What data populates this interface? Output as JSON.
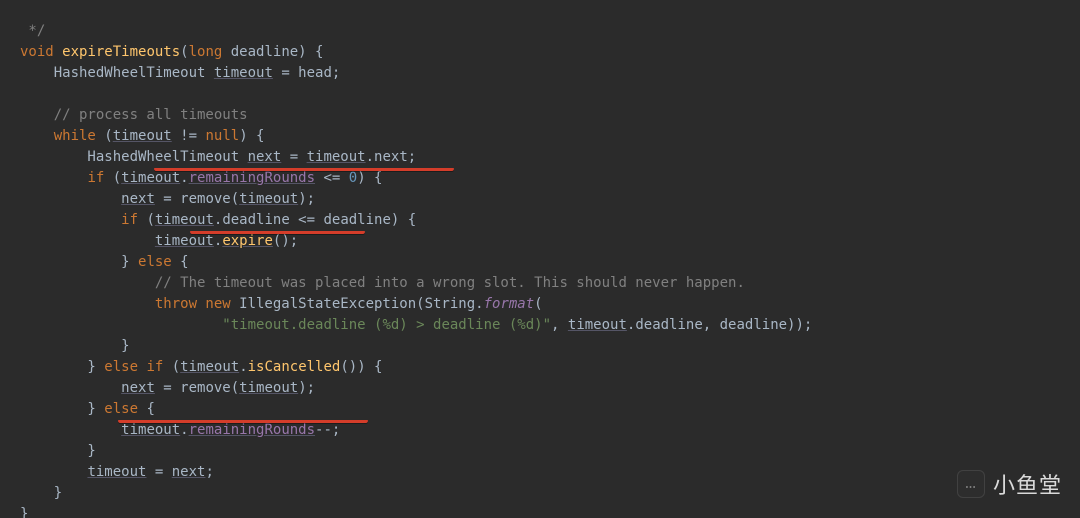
{
  "colors": {
    "bg": "#2b2b2b",
    "keyword": "#cc7832",
    "method": "#ffc66d",
    "field": "#9876aa",
    "number": "#6897bb",
    "comment": "#808080",
    "string": "#6a8759",
    "default": "#a9b7c6",
    "underline": "#d43d2a"
  },
  "underlines": [
    "timeout.remainingRounds <= 0",
    "timeout.expire();",
    "timeout.remainingRounds--;"
  ],
  "watermark": {
    "icon_glyph": "…",
    "label": "小鱼堂"
  },
  "code": {
    "l0": {
      "a": " */"
    },
    "l1": {
      "a": "void",
      "b": " ",
      "c": "expireTimeouts",
      "d": "(",
      "e": "long",
      "f": " deadline) {"
    },
    "l2": {
      "a": "    HashedWheelTimeout ",
      "b": "timeout",
      "c": " = head;"
    },
    "l3": {
      "a": ""
    },
    "l4": {
      "a": "    ",
      "b": "// process all timeouts"
    },
    "l5": {
      "a": "    ",
      "b": "while",
      "c": " (",
      "d": "timeout",
      "e": " != ",
      "f": "null",
      "g": ") {"
    },
    "l6": {
      "a": "        HashedWheelTimeout ",
      "b": "next",
      "c": " = ",
      "d": "timeout",
      "e": ".next;"
    },
    "l7": {
      "a": "        ",
      "b": "if",
      "c": " (",
      "d": "timeout",
      "e": ".",
      "f": "remainingRounds",
      "g": " <= ",
      "h": "0",
      "i": ") {"
    },
    "l8": {
      "a": "            ",
      "b": "next",
      "c": " = remove(",
      "d": "timeout",
      "e": ");"
    },
    "l9": {
      "a": "            ",
      "b": "if",
      "c": " (",
      "d": "timeout",
      "e": ".deadline <= deadline) {"
    },
    "l10": {
      "a": "                ",
      "b": "timeout",
      "c": ".",
      "d": "expire",
      "e": "();"
    },
    "l11": {
      "a": "            } ",
      "b": "else",
      "c": " {"
    },
    "l12": {
      "a": "                ",
      "b": "// The timeout was placed into a wrong slot. This should never happen."
    },
    "l13": {
      "a": "                ",
      "b": "throw new",
      "c": " IllegalStateException(String.",
      "d": "format",
      "e": "("
    },
    "l14": {
      "a": "                        ",
      "b": "\"timeout.deadline (%d) > deadline (%d)\"",
      "c": ", ",
      "d": "timeout",
      "e": ".deadline, deadline));"
    },
    "l15": {
      "a": "            }"
    },
    "l16": {
      "a": "        } ",
      "b": "else if",
      "c": " (",
      "d": "timeout",
      "e": ".",
      "f": "isCancelled",
      "g": "()) {"
    },
    "l17": {
      "a": "            ",
      "b": "next",
      "c": " = remove(",
      "d": "timeout",
      "e": ");"
    },
    "l18": {
      "a": "        } ",
      "b": "else",
      "c": " {"
    },
    "l19": {
      "a": "            ",
      "b": "timeout",
      "c": ".",
      "d": "remainingRounds",
      "e": "--;"
    },
    "l20": {
      "a": "        }"
    },
    "l21": {
      "a": "        ",
      "b": "timeout",
      "c": " = ",
      "d": "next",
      "e": ";"
    },
    "l22": {
      "a": "    }"
    },
    "l23": {
      "a": "}"
    }
  }
}
